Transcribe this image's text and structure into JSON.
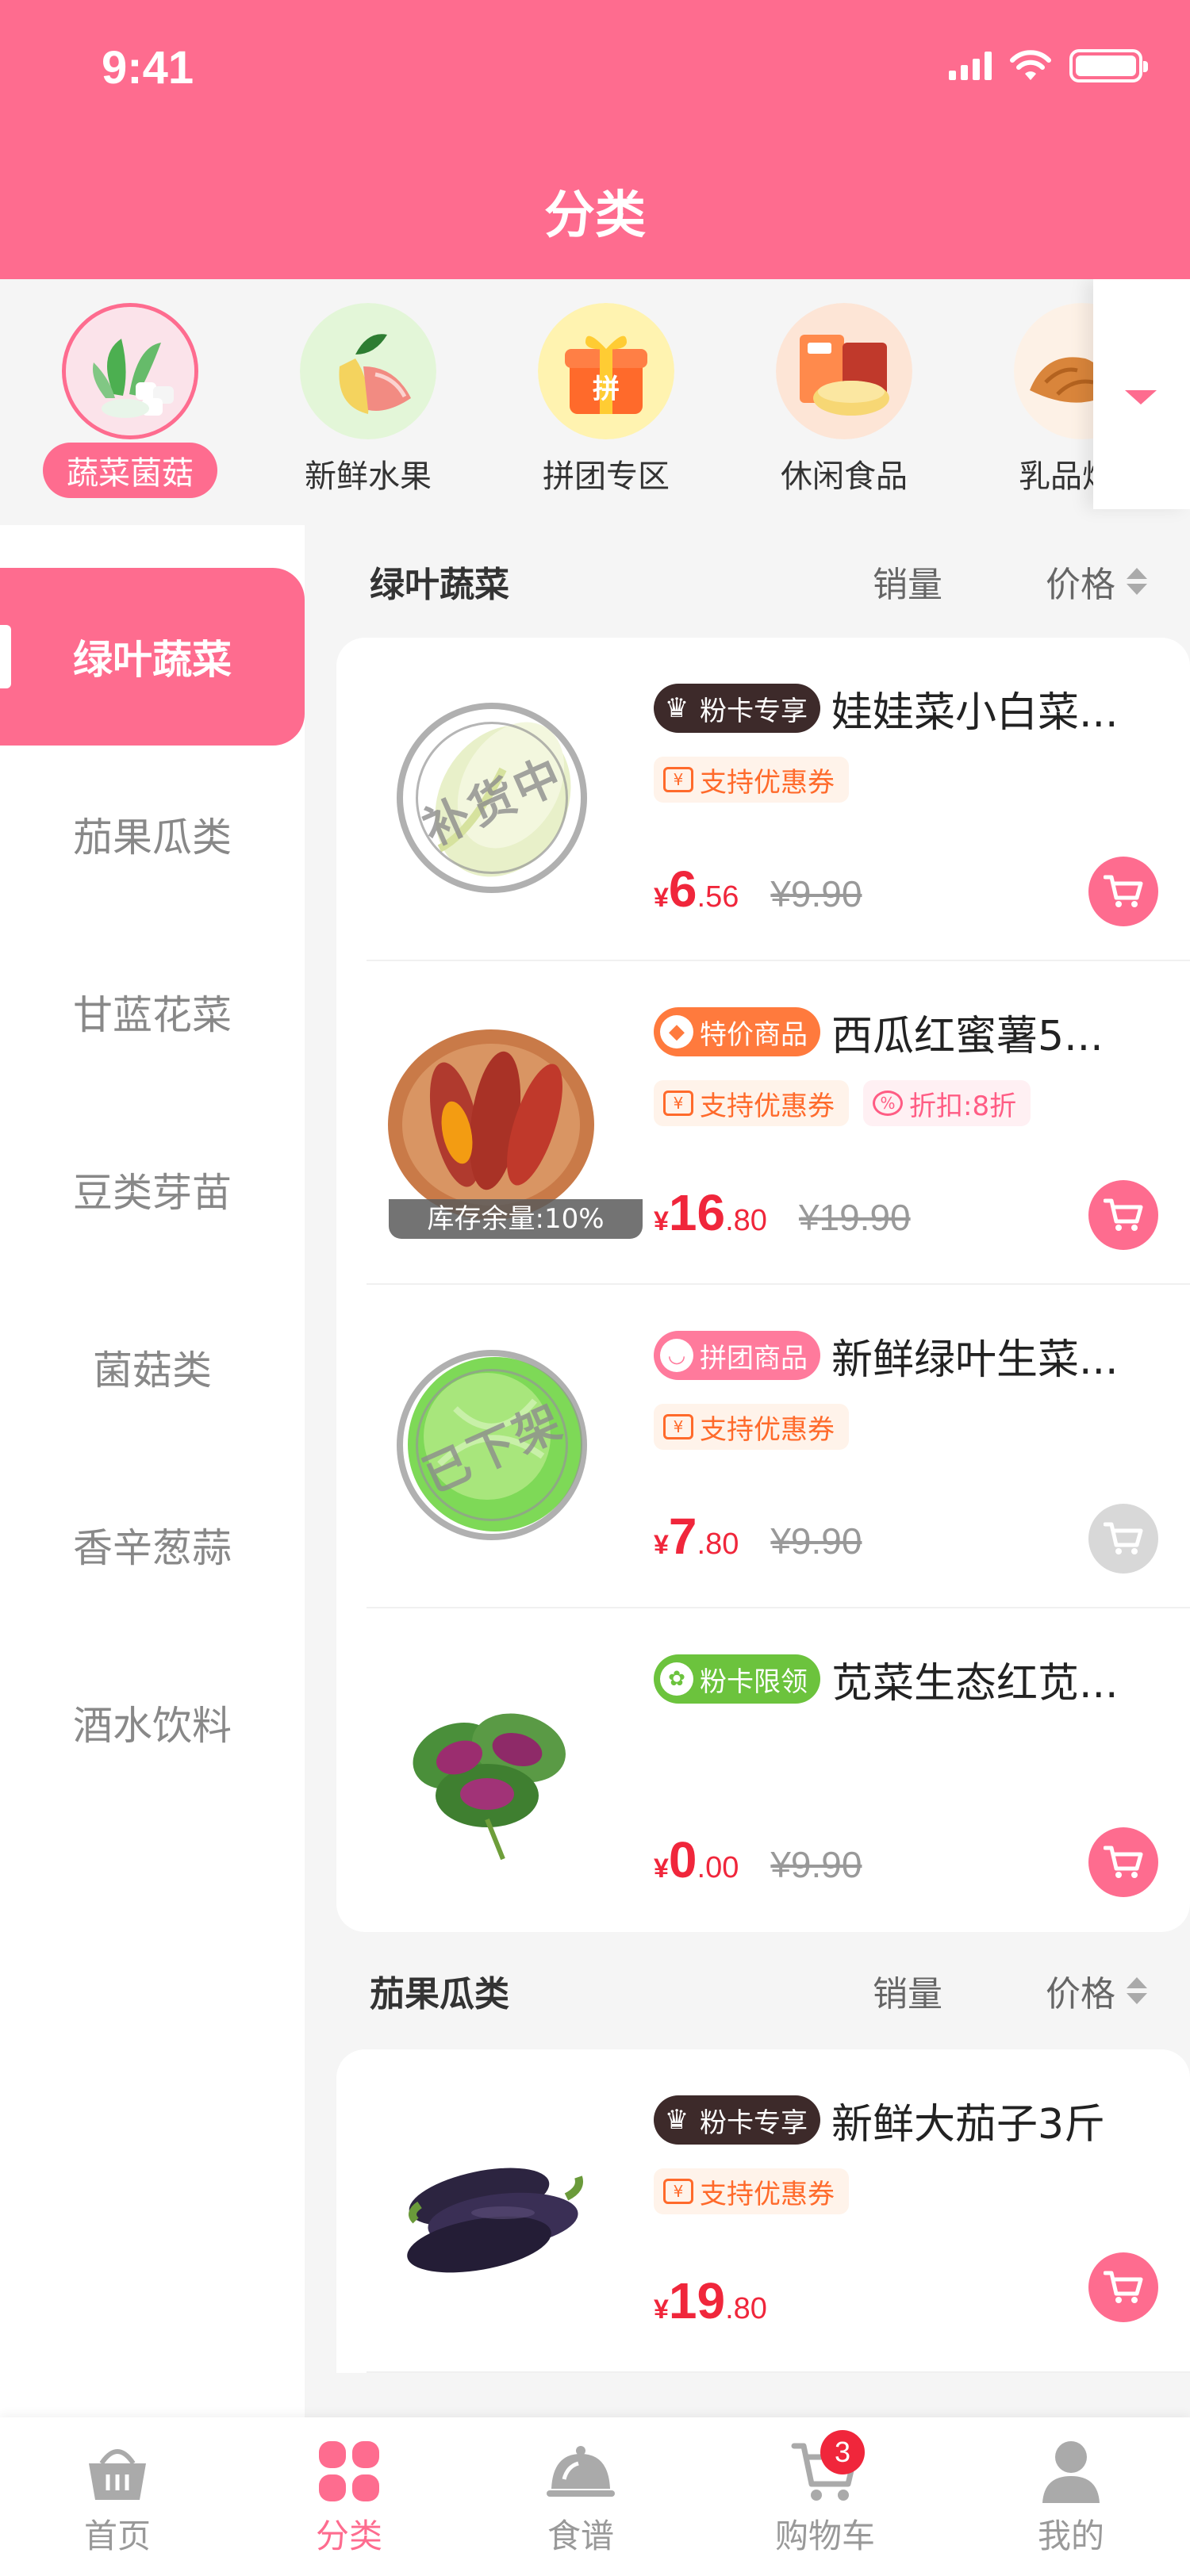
{
  "status": {
    "time": "9:41"
  },
  "header": {
    "title": "分类"
  },
  "top_categories": [
    {
      "label": "蔬菜菌菇",
      "active": true
    },
    {
      "label": "新鲜水果",
      "active": false
    },
    {
      "label": "拼团专区",
      "active": false
    },
    {
      "label": "休闲食品",
      "active": false
    },
    {
      "label": "乳品烘焙",
      "active": false
    }
  ],
  "sidebar": {
    "items": [
      {
        "label": "绿叶蔬菜",
        "active": true
      },
      {
        "label": "茄果瓜类"
      },
      {
        "label": "甘蓝花菜"
      },
      {
        "label": "豆类芽苗"
      },
      {
        "label": "菌菇类"
      },
      {
        "label": "香辛葱蒜"
      },
      {
        "label": "酒水饮料"
      }
    ]
  },
  "sort": {
    "sales": "销量",
    "price": "价格"
  },
  "sections": [
    {
      "title": "绿叶蔬菜",
      "products": [
        {
          "badge": "粉卡专享",
          "name": "娃娃菜小白菜...",
          "tags": [
            "支持优惠券"
          ],
          "price_int": "6",
          "price_dec": ".56",
          "old_price": "¥9.90",
          "stamp": "补货中",
          "cart_enabled": true
        },
        {
          "badge": "特价商品",
          "name": "西瓜红蜜薯5...",
          "tags": [
            "支持优惠券",
            "折扣:8折"
          ],
          "price_int": "16",
          "price_dec": ".80",
          "old_price": "¥19.90",
          "stock": "库存余量:10%",
          "cart_enabled": true
        },
        {
          "badge": "拼团商品",
          "name": "新鲜绿叶生菜...",
          "tags": [
            "支持优惠券"
          ],
          "price_int": "7",
          "price_dec": ".80",
          "old_price": "¥9.90",
          "stamp": "已下架",
          "cart_enabled": false
        },
        {
          "badge": "粉卡限领",
          "name": "苋菜生态红苋...",
          "tags": [],
          "price_int": "0",
          "price_dec": ".00",
          "old_price": "¥9.90",
          "cart_enabled": true
        }
      ]
    },
    {
      "title": "茄果瓜类",
      "products": [
        {
          "badge": "粉卡专享",
          "name": "新鲜大茄子3斤",
          "tags": [
            "支持优惠券"
          ],
          "price_int": "19",
          "price_dec": ".80",
          "old_price": "",
          "cart_enabled": true
        }
      ]
    }
  ],
  "currency": "¥",
  "bottom_nav": [
    {
      "label": "首页",
      "icon": "basket-icon"
    },
    {
      "label": "分类",
      "icon": "category-grid-icon",
      "active": true
    },
    {
      "label": "食谱",
      "icon": "cloche-icon"
    },
    {
      "label": "购物车",
      "icon": "cart-icon",
      "badge": "3"
    },
    {
      "label": "我的",
      "icon": "user-icon"
    }
  ],
  "colors": {
    "brand": "#fe6c8f",
    "price": "#f0263b",
    "coupon": "#ff6a2b"
  }
}
